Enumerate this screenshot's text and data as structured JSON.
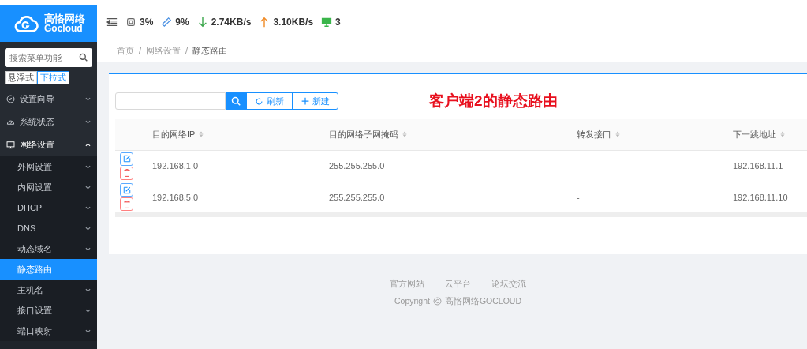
{
  "logo": {
    "name": "高恪网络",
    "sub": "Gocloud"
  },
  "sidebar": {
    "search": {
      "placeholder": "搜索菜单功能"
    },
    "modes": [
      {
        "label": "悬浮式",
        "selected": false
      },
      {
        "label": "下拉式",
        "selected": true
      }
    ],
    "items": [
      {
        "label": "设置向导",
        "kind": "wizard",
        "expanded": false
      },
      {
        "label": "系统状态",
        "kind": "gauge",
        "expanded": false
      },
      {
        "label": "网络设置",
        "kind": "monitor",
        "expanded": true,
        "children": [
          {
            "label": "外网设置",
            "selected": false,
            "expandable": true
          },
          {
            "label": "内网设置",
            "selected": false,
            "expandable": true
          },
          {
            "label": "DHCP",
            "selected": false,
            "expandable": true
          },
          {
            "label": "DNS",
            "selected": false,
            "expandable": true
          },
          {
            "label": "动态域名",
            "selected": false,
            "expandable": true
          },
          {
            "label": "静态路由",
            "selected": true,
            "expandable": false
          },
          {
            "label": "主机名",
            "selected": false,
            "expandable": true
          },
          {
            "label": "接口设置",
            "selected": false,
            "expandable": true
          },
          {
            "label": "端口映射",
            "selected": false,
            "expandable": true
          }
        ]
      }
    ]
  },
  "status": [
    {
      "kind": "cpu",
      "value": "3%"
    },
    {
      "kind": "memory",
      "value": "9%"
    },
    {
      "kind": "down",
      "value": "2.74KB/s"
    },
    {
      "kind": "up",
      "value": "3.10KB/s"
    },
    {
      "kind": "clients",
      "value": "3"
    }
  ],
  "breadcrumb": {
    "items": [
      "首页",
      "网络设置",
      "静态路由"
    ],
    "separators": [
      "/",
      "/"
    ]
  },
  "toolbar": {
    "refresh": "刷新",
    "create": "新建"
  },
  "annotation": "客户端2的静态路由",
  "table": {
    "columns": [
      "目的网络IP",
      "目的网络子网掩码",
      "转发接口",
      "下一跳地址"
    ],
    "rows": [
      [
        "192.168.1.0",
        "255.255.255.0",
        "-",
        "192.168.11.1"
      ],
      [
        "192.168.5.0",
        "255.255.255.0",
        "-",
        "192.168.11.10"
      ]
    ]
  },
  "footer": {
    "links": [
      "官方网站",
      "云平台",
      "论坛交流"
    ],
    "copyright": "Copyright",
    "company": "高恪网络GOCLOUD"
  }
}
